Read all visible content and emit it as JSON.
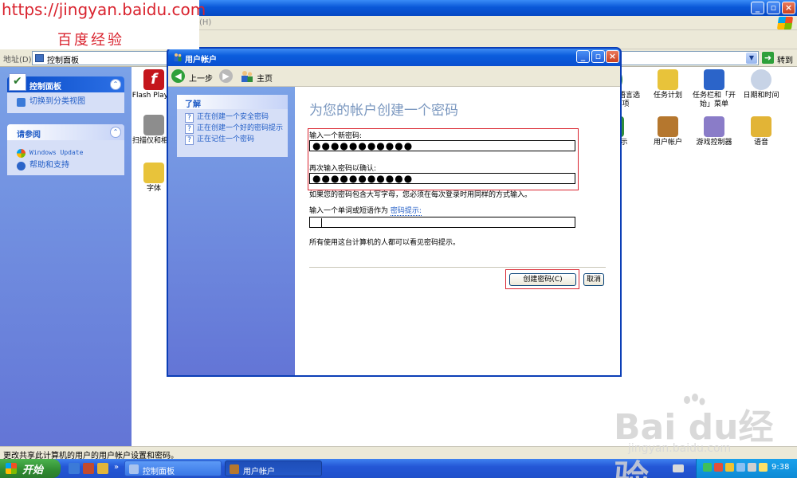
{
  "watermark": {
    "url": "https://jingyan.baidu.com",
    "brand": "百度经验",
    "logo_text": "Bai du经验",
    "logo_url": "jingyan.baidu.com"
  },
  "control_panel": {
    "menu_trail": "(H)",
    "address_label": "地址(D)",
    "address_value": "控制面板",
    "go_label": "转到",
    "sidebar": {
      "panel1": {
        "title": "控制面板",
        "items": [
          "切换到分类视图"
        ]
      },
      "panel2": {
        "title": "请参阅",
        "items": [
          "Windows Update",
          "帮助和支持"
        ]
      }
    },
    "icons": [
      {
        "label": "Flash Player",
        "icon": "flash-icon",
        "color": "#c4161c"
      },
      {
        "label": "扫描仪和相机",
        "icon": "scanner-camera-icon",
        "color": "#6b6b6b"
      },
      {
        "label": "字体",
        "icon": "fonts-folder-icon",
        "color": "#e8c33a"
      },
      {
        "label": "和语言选项",
        "icon": "globe-icon",
        "color": "#2f8d3a"
      },
      {
        "label": "任务计划",
        "icon": "scheduled-tasks-icon",
        "color": "#e8c33a"
      },
      {
        "label": "任务栏和「开始」菜单",
        "icon": "taskbar-icon",
        "color": "#2b64c9"
      },
      {
        "label": "日期和时间",
        "icon": "clock-icon",
        "color": "#8aa0c6"
      },
      {
        "label": "示",
        "icon": "display-icon",
        "color": "#2f8d3a"
      },
      {
        "label": "用户帐户",
        "icon": "user-accounts-icon",
        "color": "#b5772e"
      },
      {
        "label": "游戏控制器",
        "icon": "game-controller-icon",
        "color": "#8a7cc8"
      },
      {
        "label": "语音",
        "icon": "speech-icon",
        "color": "#e2b436"
      }
    ],
    "status_text": "更改共享此计算机的用户的用户帐户设置和密码。"
  },
  "dialog": {
    "title": "用户帐户",
    "back_label": "上一步",
    "home_label": "主页",
    "learn": {
      "title": "了解",
      "items": [
        "正在创建一个安全密码",
        "正在创建一个好的密码提示",
        "正在记住一个密码"
      ]
    },
    "heading": "为您的帐户创建一个密码",
    "new_password_label": "输入一个新密码:",
    "new_password_value": "●●●●●●●●●●●",
    "confirm_label": "再次输入密码以确认:",
    "confirm_value": "●●●●●●●●●●●",
    "caps_note": "如果您的密码包含大写字母，您必须在每次登录时用同样的方式输入。",
    "hint_label": "输入一个单词或短语作为",
    "hint_link": "密码提示:",
    "hint_value": "",
    "visible_note": "所有使用这台计算机的人都可以看见密码提示。",
    "create_button": "创建密码(C)",
    "cancel_button": "取消"
  },
  "taskbar": {
    "start_label": "开始",
    "tasks": [
      {
        "label": "控制面板",
        "active": false
      },
      {
        "label": "用户帐户",
        "active": true
      }
    ],
    "clock": "9:38"
  }
}
